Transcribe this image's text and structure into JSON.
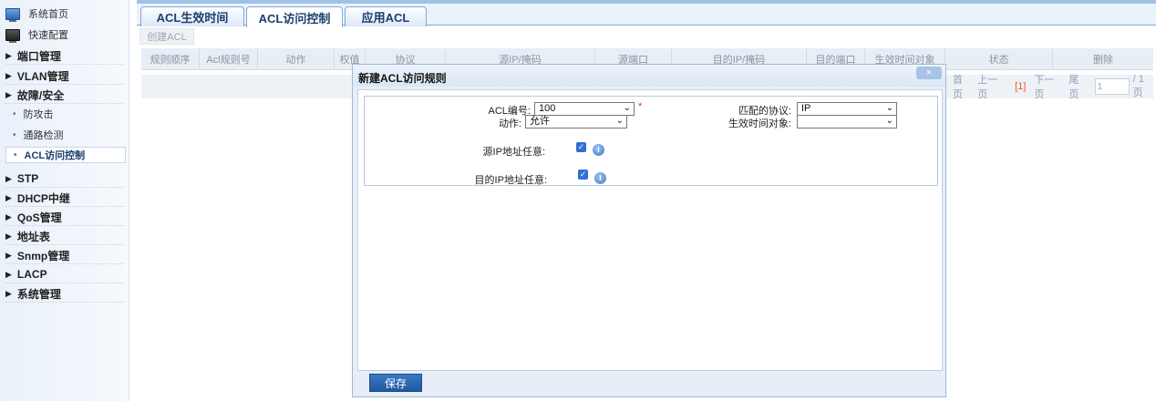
{
  "sidebar": {
    "top_items": [
      {
        "label": "系统首页",
        "icon": "home-monitor-icon"
      },
      {
        "label": "快速配置",
        "icon": "quick-config-monitor-icon"
      }
    ],
    "groups": [
      {
        "label": "端口管理"
      },
      {
        "label": "VLAN管理"
      },
      {
        "label": "故障/安全"
      },
      {
        "label": "STP"
      },
      {
        "label": "DHCP中继"
      },
      {
        "label": "QoS管理"
      },
      {
        "label": "地址表"
      },
      {
        "label": "Snmp管理"
      },
      {
        "label": "LACP"
      },
      {
        "label": "系统管理"
      }
    ],
    "sub_items": [
      {
        "label": "防攻击"
      },
      {
        "label": "通路检测"
      },
      {
        "label": "ACL访问控制",
        "active": true
      }
    ],
    "bullet": "•",
    "triangle": "▶"
  },
  "tabs": [
    {
      "label": "ACL生效时间"
    },
    {
      "label": "ACL访问控制",
      "active": true
    },
    {
      "label": "应用ACL"
    }
  ],
  "toolbar": {
    "create_label": "创建ACL"
  },
  "table": {
    "columns": [
      "规则顺序",
      "Acl规则号",
      "动作",
      "权值",
      "协议",
      "源IP/掩码",
      "源端口",
      "目的IP/掩码",
      "目的端口",
      "生效时间对象",
      "状态",
      "删除"
    ]
  },
  "pager": {
    "first": "首页",
    "prev": "上一页",
    "current": "[1]",
    "next": "下一页",
    "last": "尾页",
    "page_input": "1",
    "total": "/ 1 页"
  },
  "dialog": {
    "title": "新建ACL访问规则",
    "close_icon": "×",
    "acl_number_label": "ACL编号:",
    "acl_number_value": "100",
    "required_mark": "*",
    "action_label": "动作:",
    "action_value": "允许",
    "protocol_label": "匹配的协议:",
    "protocol_value": "IP",
    "time_object_label": "生效时间对象:",
    "time_object_value": "",
    "src_any_label": "源IP地址任意:",
    "src_any_checked": true,
    "dst_any_label": "目的IP地址任意:",
    "dst_any_checked": true,
    "info_glyph": "i",
    "check_glyph": "✓",
    "select_arrow": "⌄",
    "save_label": "保存"
  },
  "colors": {
    "accent": "#1f58a0",
    "tab_text": "#1a3f6d",
    "required": "#dd3333",
    "pager_current": "#e35b2a"
  }
}
